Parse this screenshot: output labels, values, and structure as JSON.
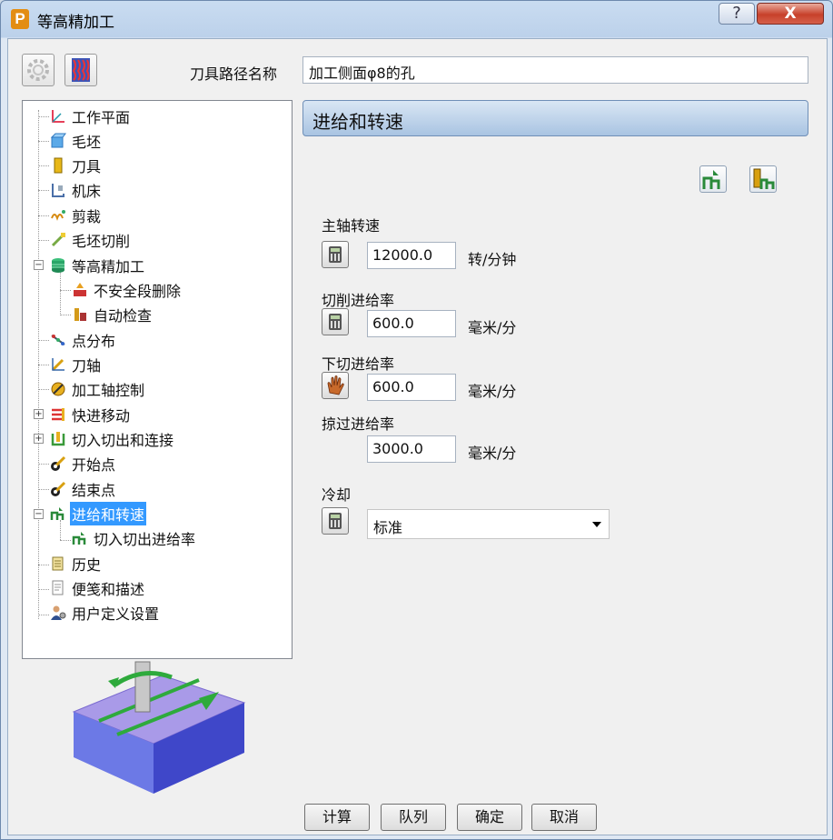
{
  "window": {
    "title": "等高精加工",
    "app_icon_letter": "P",
    "help_label": "?",
    "close_label": "X"
  },
  "header": {
    "toolpath_name_label": "刀具路径名称",
    "toolpath_name_value": "加工侧面φ8的孔"
  },
  "tree": {
    "items": [
      {
        "label": "工作平面",
        "icon": "workplane-icon"
      },
      {
        "label": "毛坯",
        "icon": "block-icon"
      },
      {
        "label": "刀具",
        "icon": "tool-icon"
      },
      {
        "label": "机床",
        "icon": "machine-icon"
      },
      {
        "label": "剪裁",
        "icon": "limit-icon"
      },
      {
        "label": "毛坯切削",
        "icon": "stock-cut-icon"
      },
      {
        "label": "等高精加工",
        "icon": "constant-z-icon",
        "expanded": true
      },
      {
        "label": "不安全段删除",
        "icon": "unsafe-segment-icon"
      },
      {
        "label": "自动检查",
        "icon": "auto-verify-icon"
      },
      {
        "label": "点分布",
        "icon": "point-distribution-icon"
      },
      {
        "label": "刀轴",
        "icon": "tool-axis-icon"
      },
      {
        "label": "加工轴控制",
        "icon": "axis-control-icon"
      },
      {
        "label": "快进移动",
        "icon": "rapid-move-icon",
        "expandable": true
      },
      {
        "label": "切入切出和连接",
        "icon": "leads-links-icon",
        "expandable": true
      },
      {
        "label": "开始点",
        "icon": "start-point-icon"
      },
      {
        "label": "结束点",
        "icon": "end-point-icon"
      },
      {
        "label": "进给和转速",
        "icon": "feeds-speeds-icon",
        "expanded": true,
        "selected": true
      },
      {
        "label": "切入切出进给率",
        "icon": "lead-feed-icon"
      },
      {
        "label": "历史",
        "icon": "history-icon"
      },
      {
        "label": "便笺和描述",
        "icon": "notes-icon"
      },
      {
        "label": "用户定义设置",
        "icon": "user-settings-icon"
      }
    ]
  },
  "panel": {
    "title": "进给和转速",
    "spindle_label": "主轴转速",
    "spindle_value": "12000.0",
    "spindle_unit": "转/分钟",
    "cutting_feed_label": "切削进给率",
    "cutting_feed_value": "600.0",
    "cutting_feed_unit": "毫米/分",
    "plunge_feed_label": "下切进给率",
    "plunge_feed_value": "600.0",
    "plunge_feed_unit": "毫米/分",
    "skim_feed_label": "掠过进给率",
    "skim_feed_value": "3000.0",
    "skim_feed_unit": "毫米/分",
    "coolant_label": "冷却",
    "coolant_value": "标准"
  },
  "footer": {
    "calculate": "计算",
    "queue": "队列",
    "ok": "确定",
    "cancel": "取消"
  },
  "colors": {
    "selection": "#3399ff",
    "section_bar": "#a9c4e2",
    "preview_top": "#a99ae8",
    "preview_arrow": "#2eaa3c"
  }
}
